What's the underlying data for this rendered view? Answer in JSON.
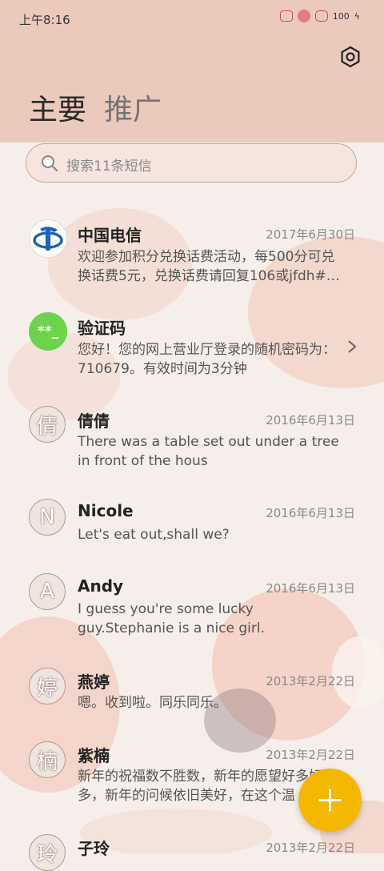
{
  "status": {
    "time": "上午8:16",
    "battery": "100"
  },
  "tabs": {
    "primary": "主要",
    "promo": "推广"
  },
  "search": {
    "placeholder": "搜索11条短信"
  },
  "messages": [
    {
      "name": "中国电信",
      "date": "2017年6月30日",
      "preview": "欢迎参加积分兑换话费活动，每500分可兑换话费5元，兑换话费请回复106或jfdh#…",
      "avatar": "telecom"
    },
    {
      "name": "验证码",
      "date": "",
      "preview": "您好！您的网上营业厅登录的随机密码为：710679。有效时间为3分钟",
      "avatar": "code",
      "avatar_text": "**_"
    },
    {
      "name": "倩倩",
      "date": "2016年6月13日",
      "preview": "There was a table set out under a tree in front of the hous",
      "avatar_text": "倩"
    },
    {
      "name": "Nicole",
      "date": "2016年6月13日",
      "preview": "Let's eat out,shall we?",
      "avatar_text": "N"
    },
    {
      "name": "Andy",
      "date": "2016年6月13日",
      "preview": "I guess you're some lucky guy.Stephanie is a nice girl.",
      "avatar_text": "A"
    },
    {
      "name": "燕婷",
      "date": "2013年2月22日",
      "preview": "嗯。收到啦。同乐同乐。",
      "avatar_text": "婷"
    },
    {
      "name": "紫楠",
      "date": "2013年2月22日",
      "preview": "新年的祝福数不胜数，新年的愿望好多好多，新年的问候依旧美好，在这个温",
      "avatar_text": "楠"
    },
    {
      "name": "子玲",
      "date": "2013年2月22日",
      "preview": "",
      "avatar_text": "玲"
    }
  ],
  "colors": {
    "header": "#ecc9bd",
    "fab": "#f5b800",
    "code_avatar": "#6cd44a"
  },
  "icons": [
    "settings-icon",
    "search-icon",
    "chevron-right-icon",
    "plus-icon"
  ]
}
